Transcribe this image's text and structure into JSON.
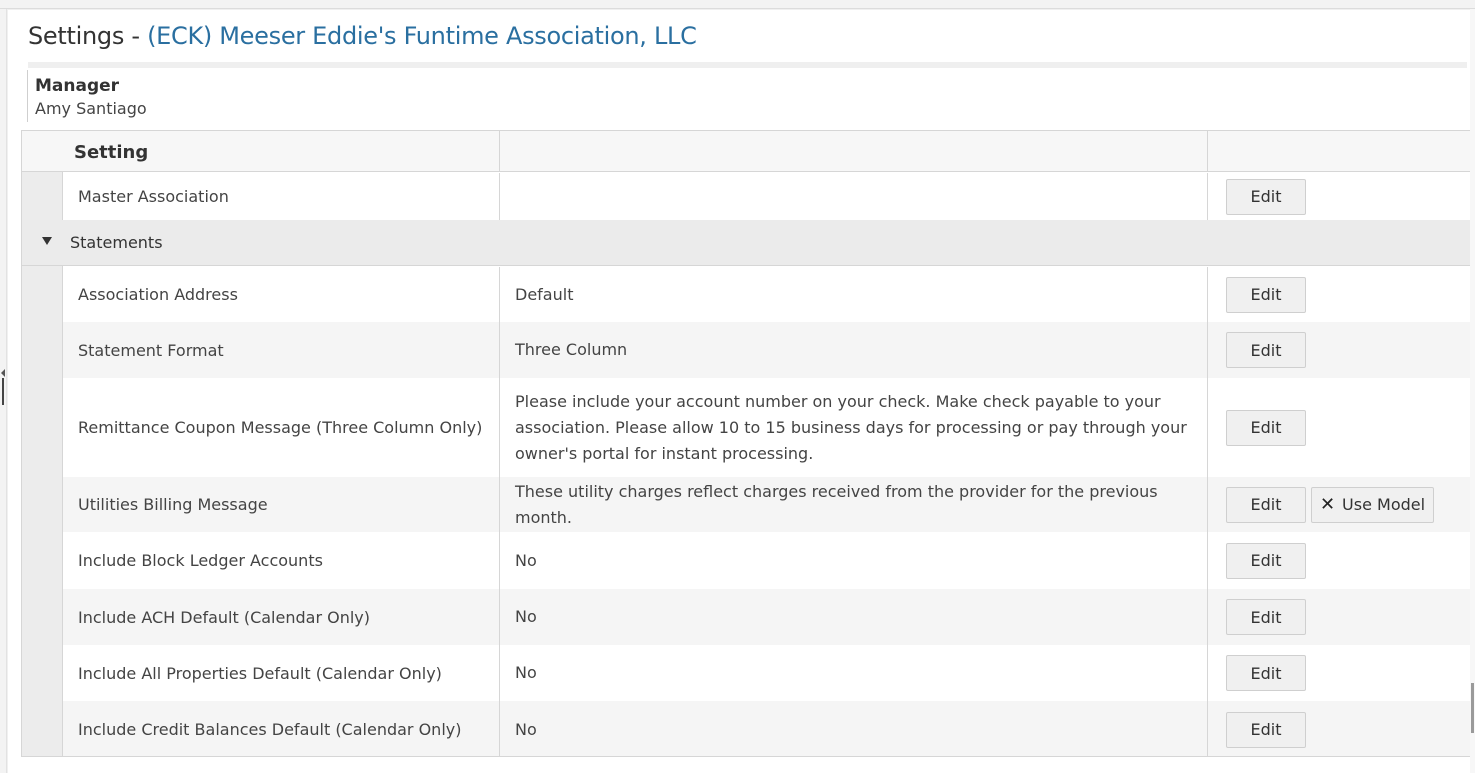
{
  "header": {
    "title_prefix": "Settings - ",
    "association_name": "(ECK) Meeser Eddie's Funtime Association, LLC"
  },
  "manager": {
    "label": "Manager",
    "name": "Amy Santiago"
  },
  "table": {
    "column_setting": "Setting",
    "rows_top": [
      {
        "setting": "Master Association",
        "value": "",
        "edit": "Edit"
      }
    ],
    "group": {
      "label": "Statements",
      "rows": [
        {
          "setting": "Association Address",
          "value": "Default",
          "edit": "Edit"
        },
        {
          "setting": "Statement Format",
          "value": "Three Column",
          "edit": "Edit"
        },
        {
          "setting": "Remittance Coupon Message (Three Column Only)",
          "value": "Please include your account number on your check. Make check payable to your association. Please allow 10 to 15 business days for processing or pay through your owner's portal for instant processing.",
          "edit": "Edit"
        },
        {
          "setting": "Utilities Billing Message",
          "value": "These utility charges reflect charges received from the provider for the previous month.",
          "edit": "Edit",
          "use_model": "Use Model"
        },
        {
          "setting": "Include Block Ledger Accounts",
          "value": "No",
          "edit": "Edit"
        },
        {
          "setting": "Include ACH Default (Calendar Only)",
          "value": "No",
          "edit": "Edit"
        },
        {
          "setting": "Include All Properties Default (Calendar Only)",
          "value": "No",
          "edit": "Edit"
        },
        {
          "setting": "Include Credit Balances Default (Calendar Only)",
          "value": "No",
          "edit": "Edit"
        }
      ]
    }
  },
  "icons": {
    "group_toggle": "caret-down-icon",
    "use_model": "close-x-icon"
  },
  "colors": {
    "link": "#2a6fa0",
    "row_alt": "#f5f5f5",
    "group_bg": "#ebebeb"
  }
}
